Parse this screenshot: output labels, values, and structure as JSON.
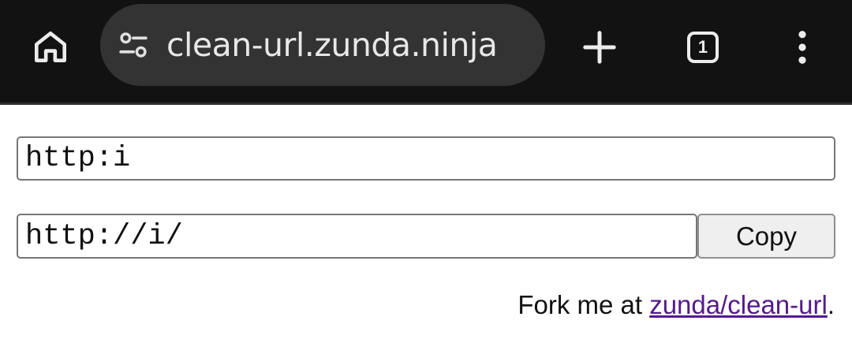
{
  "browser": {
    "url": "clean-url.zunda.ninja",
    "tab_count": "1",
    "icons": {
      "home": "home-icon",
      "site_settings": "tune-icon",
      "new_tab": "plus-icon",
      "tabs": "tab-switcher-icon",
      "menu": "more-vert-icon"
    },
    "colors": {
      "toolbar_bg": "#121212",
      "omnibox_bg": "#333333"
    }
  },
  "page": {
    "source_input_value": "http:i",
    "output_input_value": "http://i/",
    "copy_label": "Copy",
    "fork_prefix": "Fork me at ",
    "fork_link_text": "zunda/clean-url",
    "fork_suffix": ".",
    "colors": {
      "link": "#551a8b"
    }
  }
}
